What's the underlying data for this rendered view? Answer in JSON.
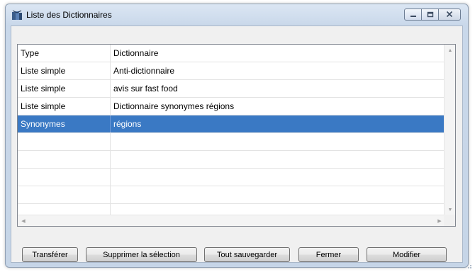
{
  "window": {
    "title": "Liste des Dictionnaires",
    "controls": {
      "minimize": "minimize-icon",
      "maximize": "maximize-icon",
      "close": "close-icon"
    }
  },
  "table": {
    "columns": [
      "Type",
      "Dictionnaire"
    ],
    "rows": [
      {
        "type": "Liste simple",
        "dictionnaire": "Anti-dictionnaire"
      },
      {
        "type": "Liste simple",
        "dictionnaire": "avis sur fast food"
      },
      {
        "type": "Liste simple",
        "dictionnaire": "Dictionnaire synonymes régions"
      },
      {
        "type": "Synonymes",
        "dictionnaire": "régions"
      }
    ],
    "selected_row": 4,
    "selection_color": "#3a79c4"
  },
  "buttons": {
    "transferer": "Transférer",
    "supprimer": "Supprimer la sélection",
    "sauvegarder": "Tout sauvegarder",
    "fermer": "Fermer",
    "modifier": "Modifier"
  }
}
